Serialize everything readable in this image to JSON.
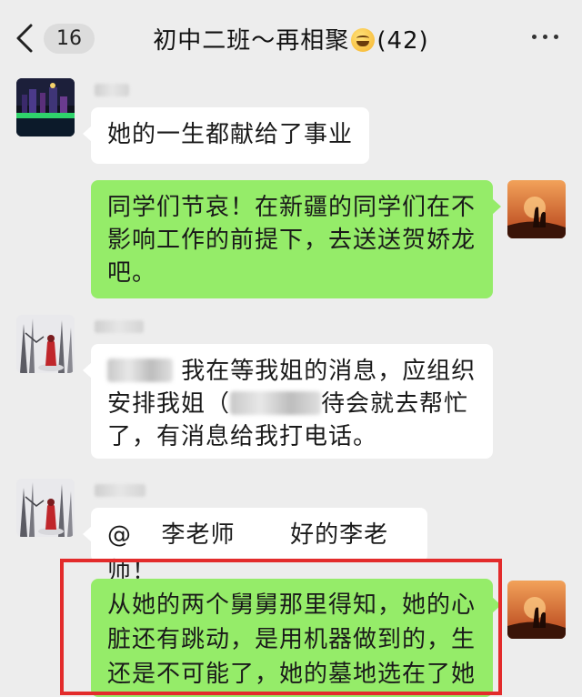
{
  "header": {
    "back_count": "16",
    "title_prefix": "初中二班～再相聚",
    "title_suffix": "(42)"
  },
  "messages": [
    {
      "id": "m1",
      "direction": "in",
      "text": "她的一生都献给了事业"
    },
    {
      "id": "m2",
      "direction": "out",
      "lines": [
        "同学们节哀！在新疆的同学们在不",
        "影响工作的前提下，去送送贺娇龙",
        "吧。"
      ]
    },
    {
      "id": "m3",
      "direction": "in",
      "line1_after_blur": "我在等我姐的消息，应组织",
      "line2_before_blur": "安排我姐（",
      "line2_after_blur": "待会就去帮忙",
      "line3": "了，有消息给我打电话。"
    },
    {
      "id": "m4",
      "direction": "in",
      "mention": "@",
      "mention_name": "李老师",
      "text": "好的李老师！"
    },
    {
      "id": "m5",
      "direction": "out",
      "lines": [
        "从她的两个舅舅那里得知，她的心",
        "脏还有跳动，是用机器做到的，生",
        "还是不可能了，她的墓地选在了她"
      ]
    }
  ],
  "colors": {
    "background": "#ededed",
    "incoming_bubble": "#ffffff",
    "outgoing_bubble": "#95ec69",
    "highlight_box": "#e32b2b"
  }
}
